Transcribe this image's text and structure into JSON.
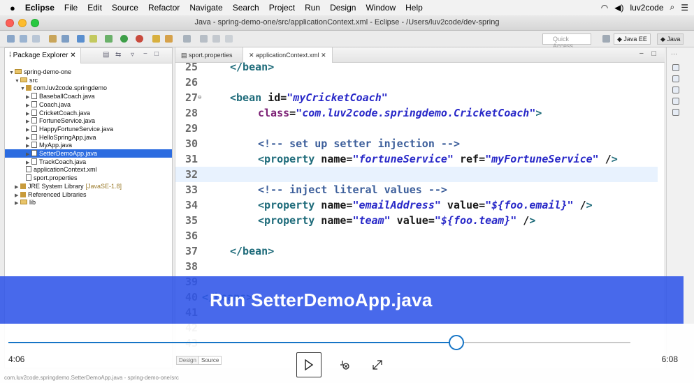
{
  "menubar": {
    "app": "Eclipse",
    "items": [
      "File",
      "Edit",
      "Source",
      "Refactor",
      "Navigate",
      "Search",
      "Project",
      "Run",
      "Design",
      "Window",
      "Help"
    ],
    "user": "luv2code"
  },
  "window": {
    "title": "Java - spring-demo-one/src/applicationContext.xml - Eclipse - /Users/luv2code/dev-spring"
  },
  "toolbar": {
    "quick_access": "Quick Access",
    "persp_java_ee": "Java EE",
    "persp_java": "Java"
  },
  "explorer": {
    "title": "Package Explorer",
    "tree": [
      {
        "label": "spring-demo-one",
        "kind": "project",
        "depth": 0,
        "arrow": "▼"
      },
      {
        "label": "src",
        "kind": "folder",
        "depth": 1,
        "arrow": "▼"
      },
      {
        "label": "com.luv2code.springdemo",
        "kind": "package",
        "depth": 2,
        "arrow": "▼"
      },
      {
        "label": "BaseballCoach.java",
        "kind": "java",
        "depth": 3,
        "arrow": "▶"
      },
      {
        "label": "Coach.java",
        "kind": "java",
        "depth": 3,
        "arrow": "▶"
      },
      {
        "label": "CricketCoach.java",
        "kind": "java",
        "depth": 3,
        "arrow": "▶"
      },
      {
        "label": "FortuneService.java",
        "kind": "java",
        "depth": 3,
        "arrow": "▶"
      },
      {
        "label": "HappyFortuneService.java",
        "kind": "java",
        "depth": 3,
        "arrow": "▶"
      },
      {
        "label": "HelloSpringApp.java",
        "kind": "java",
        "depth": 3,
        "arrow": "▶"
      },
      {
        "label": "MyApp.java",
        "kind": "java",
        "depth": 3,
        "arrow": "▶"
      },
      {
        "label": "SetterDemoApp.java",
        "kind": "java",
        "depth": 3,
        "arrow": "▶",
        "selected": true
      },
      {
        "label": "TrackCoach.java",
        "kind": "java",
        "depth": 3,
        "arrow": "▶"
      },
      {
        "label": "applicationContext.xml",
        "kind": "xml",
        "depth": 2,
        "arrow": ""
      },
      {
        "label": "sport.properties",
        "kind": "file",
        "depth": 2,
        "arrow": ""
      },
      {
        "label": "JRE System Library",
        "suffix": "[JavaSE-1.8]",
        "kind": "lib",
        "depth": 1,
        "arrow": "▶"
      },
      {
        "label": "Referenced Libraries",
        "kind": "lib",
        "depth": 1,
        "arrow": "▶"
      },
      {
        "label": "lib",
        "kind": "folder",
        "depth": 1,
        "arrow": "▶"
      }
    ]
  },
  "editor": {
    "tabs": [
      {
        "label": "sport.properties",
        "active": false
      },
      {
        "label": "applicationContext.xml",
        "active": true
      }
    ],
    "lines": [
      {
        "n": "25",
        "text": "</bean>"
      },
      {
        "n": "26",
        "text": ""
      },
      {
        "n": "27",
        "text": "<bean id=\"myCricketCoach\""
      },
      {
        "n": "28",
        "text": "class=\"com.luv2code.springdemo.CricketCoach\">"
      },
      {
        "n": "29",
        "text": ""
      },
      {
        "n": "30",
        "text": "<!-- set up setter injection -->"
      },
      {
        "n": "31",
        "text": "<property name=\"fortuneService\" ref=\"myFortuneService\" />"
      },
      {
        "n": "32",
        "text": ""
      },
      {
        "n": "33",
        "text": "<!-- inject literal values -->"
      },
      {
        "n": "34",
        "text": "<property name=\"emailAddress\" value=\"${foo.email}\" />"
      },
      {
        "n": "35",
        "text": "<property name=\"team\" value=\"${foo.team}\" />"
      },
      {
        "n": "36",
        "text": ""
      },
      {
        "n": "37",
        "text": "</bean>"
      },
      {
        "n": "38",
        "text": ""
      },
      {
        "n": "39",
        "text": ""
      },
      {
        "n": "40",
        "text": "</beans>"
      },
      {
        "n": "41",
        "text": ""
      },
      {
        "n": "42",
        "text": ""
      },
      {
        "n": "43",
        "text": ""
      }
    ],
    "design_tab": "Design",
    "source_tab": "Source"
  },
  "overlay": {
    "caption": "Run SetterDemoApp.java"
  },
  "player": {
    "current_time": "4:06",
    "duration": "6:08",
    "progress": 0.72
  },
  "status": {
    "text": "com.luv2code.springdemo.SetterDemoApp.java - spring-demo-one/src"
  },
  "colors": {
    "accent_blue": "#2f54e8",
    "progress": "#1675c6",
    "selection": "#2c6ce0"
  }
}
